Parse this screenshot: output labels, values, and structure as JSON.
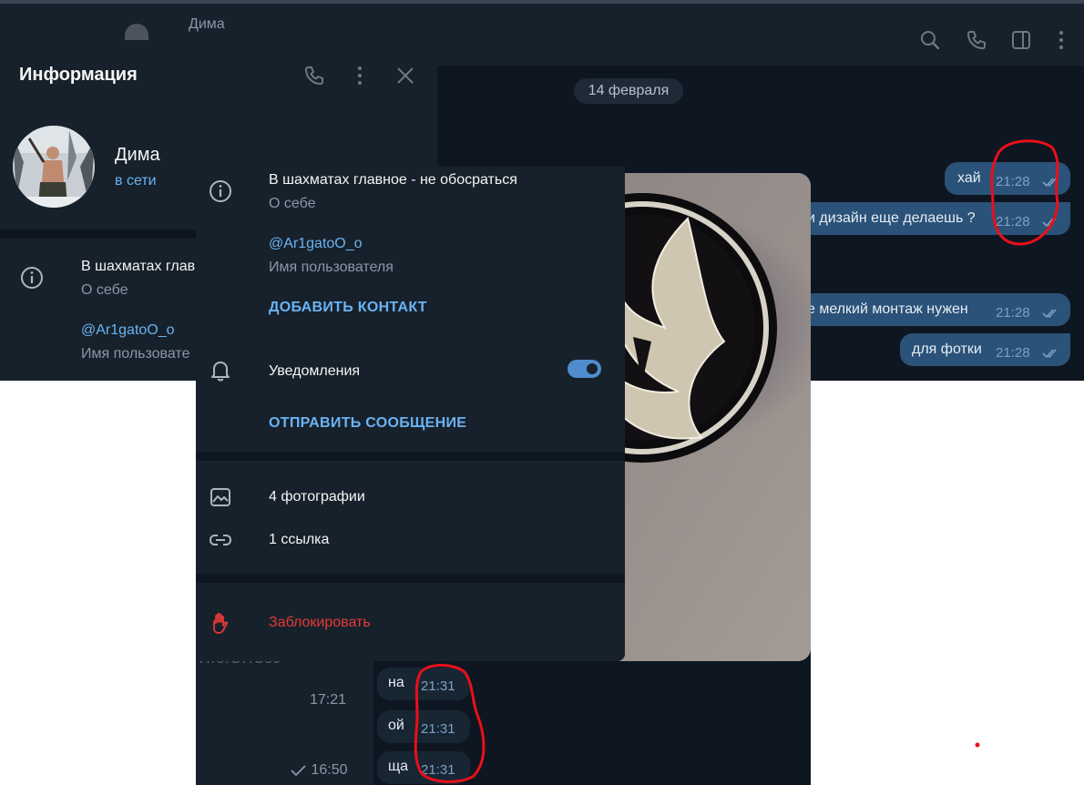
{
  "chat_header": {
    "contact_name": "Дима"
  },
  "chat": {
    "date_separator": "14 февраля",
    "messages": [
      {
        "text": "хай",
        "time": "21:28"
      },
      {
        "text": "и дизайн еще делаешь ?",
        "time": "21:28"
      },
      {
        "text": "е мелкий монтаж нужен",
        "time": "21:28"
      },
      {
        "text": "для фотки",
        "time": "21:28"
      }
    ]
  },
  "info_panel": {
    "title": "Информация",
    "user_name": "Дима",
    "user_status": "в сети",
    "bio": "В шахматах главное - не обосраться",
    "bio_truncated": "В шахматах глав",
    "bio_label": "О себе",
    "username": "@Ar1gatoO_o",
    "username_label": "Имя пользовате"
  },
  "info_card": {
    "bio": "В шахматах главное - не обосраться",
    "bio_label": "О себе",
    "username": "@Ar1gatoO_o",
    "username_label": "Имя пользователя",
    "add_contact": "ДОБАВИТЬ КОНТАКТ",
    "notifications_label": "Уведомления",
    "notifications_on": true,
    "send_message": "ОТПРАВИТЬ СООБЩЕНИЕ",
    "photos": "4 фотографии",
    "links": "1 ссылка",
    "block": "Заблокировать"
  },
  "lower_list": {
    "blurred_preview": "Пfб:ОЯЄsэ",
    "time_1": "17:21",
    "time_2": "16:50"
  },
  "lower_chat": {
    "messages": [
      {
        "text": "на",
        "time": "21:31"
      },
      {
        "text": "ой",
        "time": "21:31"
      },
      {
        "text": "ща",
        "time": "21:31"
      }
    ]
  },
  "colors": {
    "app_bg": "#0e1621",
    "panel_bg": "#17212b",
    "accent": "#6ab3f3",
    "outgoing_bubble": "#2b5278",
    "danger": "#e53935",
    "annotation_red": "#e8101a"
  }
}
